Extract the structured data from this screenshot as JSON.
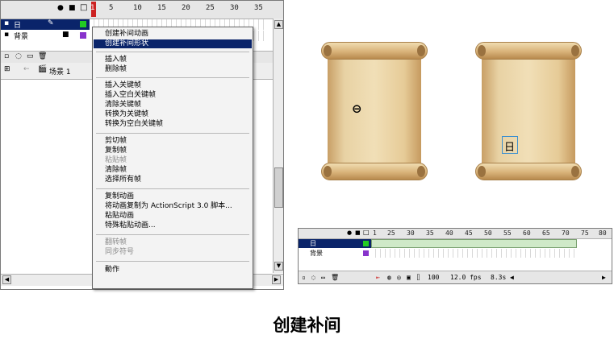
{
  "timeline": {
    "ruler_numbers": [
      "1",
      "5",
      "10",
      "15",
      "20",
      "25",
      "30",
      "35"
    ],
    "layers": [
      {
        "name": "日",
        "color": "#22cc22"
      },
      {
        "name": "背景",
        "color": "#8833cc"
      }
    ],
    "scene_label": "场景 1"
  },
  "context_menu": {
    "items": [
      {
        "label": "创建补间动画",
        "state": "normal"
      },
      {
        "label": "创建补间形状",
        "state": "highlighted"
      },
      {
        "label": "插入帧",
        "state": "normal"
      },
      {
        "label": "删除帧",
        "state": "normal"
      },
      {
        "label": "插入关键帧",
        "state": "normal"
      },
      {
        "label": "插入空白关键帧",
        "state": "normal"
      },
      {
        "label": "清除关键帧",
        "state": "normal"
      },
      {
        "label": "转换为关键帧",
        "state": "normal"
      },
      {
        "label": "转换为空白关键帧",
        "state": "normal"
      },
      {
        "label": "剪切帧",
        "state": "normal"
      },
      {
        "label": "复制帧",
        "state": "normal"
      },
      {
        "label": "粘贴帧",
        "state": "disabled"
      },
      {
        "label": "清除帧",
        "state": "normal"
      },
      {
        "label": "选择所有帧",
        "state": "normal"
      },
      {
        "label": "复制动画",
        "state": "normal"
      },
      {
        "label": "将动画复制为 ActionScript 3.0 脚本...",
        "state": "normal"
      },
      {
        "label": "粘贴动画",
        "state": "normal"
      },
      {
        "label": "特殊粘贴动画...",
        "state": "normal"
      },
      {
        "label": "翻转帧",
        "state": "disabled"
      },
      {
        "label": "同步符号",
        "state": "disabled"
      },
      {
        "label": "動作",
        "state": "normal"
      }
    ]
  },
  "stage": {
    "left_char": "⊖",
    "right_char": "日"
  },
  "timeline2": {
    "ruler_numbers": [
      "1",
      "25",
      "30",
      "35",
      "40",
      "45",
      "50",
      "55",
      "60",
      "65",
      "70",
      "75",
      "80"
    ],
    "layers": [
      {
        "name": "日",
        "color": "#22cc22"
      },
      {
        "name": "背景",
        "color": "#8833cc"
      }
    ],
    "status": {
      "frame": "100",
      "fps": "12.0 fps",
      "time": "8.3s"
    }
  },
  "caption": "创建补间"
}
